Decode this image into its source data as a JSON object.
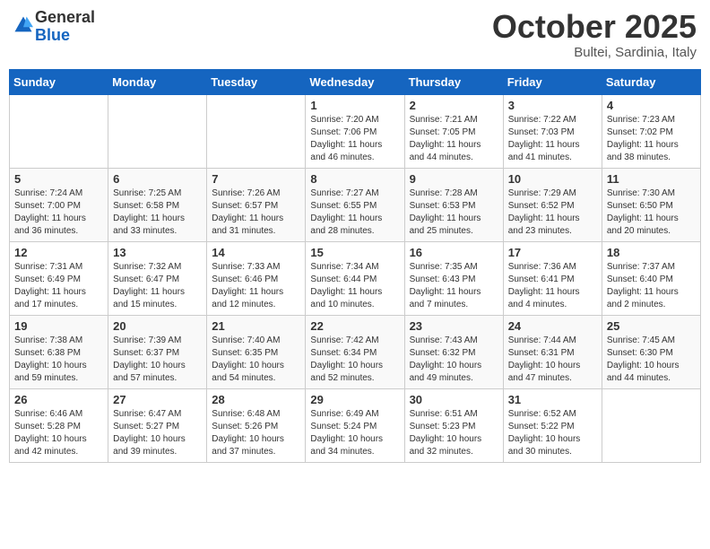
{
  "header": {
    "logo_general": "General",
    "logo_blue": "Blue",
    "month_title": "October 2025",
    "location": "Bultei, Sardinia, Italy"
  },
  "days_of_week": [
    "Sunday",
    "Monday",
    "Tuesday",
    "Wednesday",
    "Thursday",
    "Friday",
    "Saturday"
  ],
  "weeks": [
    [
      {
        "day": "",
        "info": ""
      },
      {
        "day": "",
        "info": ""
      },
      {
        "day": "",
        "info": ""
      },
      {
        "day": "1",
        "info": "Sunrise: 7:20 AM\nSunset: 7:06 PM\nDaylight: 11 hours and 46 minutes."
      },
      {
        "day": "2",
        "info": "Sunrise: 7:21 AM\nSunset: 7:05 PM\nDaylight: 11 hours and 44 minutes."
      },
      {
        "day": "3",
        "info": "Sunrise: 7:22 AM\nSunset: 7:03 PM\nDaylight: 11 hours and 41 minutes."
      },
      {
        "day": "4",
        "info": "Sunrise: 7:23 AM\nSunset: 7:02 PM\nDaylight: 11 hours and 38 minutes."
      }
    ],
    [
      {
        "day": "5",
        "info": "Sunrise: 7:24 AM\nSunset: 7:00 PM\nDaylight: 11 hours and 36 minutes."
      },
      {
        "day": "6",
        "info": "Sunrise: 7:25 AM\nSunset: 6:58 PM\nDaylight: 11 hours and 33 minutes."
      },
      {
        "day": "7",
        "info": "Sunrise: 7:26 AM\nSunset: 6:57 PM\nDaylight: 11 hours and 31 minutes."
      },
      {
        "day": "8",
        "info": "Sunrise: 7:27 AM\nSunset: 6:55 PM\nDaylight: 11 hours and 28 minutes."
      },
      {
        "day": "9",
        "info": "Sunrise: 7:28 AM\nSunset: 6:53 PM\nDaylight: 11 hours and 25 minutes."
      },
      {
        "day": "10",
        "info": "Sunrise: 7:29 AM\nSunset: 6:52 PM\nDaylight: 11 hours and 23 minutes."
      },
      {
        "day": "11",
        "info": "Sunrise: 7:30 AM\nSunset: 6:50 PM\nDaylight: 11 hours and 20 minutes."
      }
    ],
    [
      {
        "day": "12",
        "info": "Sunrise: 7:31 AM\nSunset: 6:49 PM\nDaylight: 11 hours and 17 minutes."
      },
      {
        "day": "13",
        "info": "Sunrise: 7:32 AM\nSunset: 6:47 PM\nDaylight: 11 hours and 15 minutes."
      },
      {
        "day": "14",
        "info": "Sunrise: 7:33 AM\nSunset: 6:46 PM\nDaylight: 11 hours and 12 minutes."
      },
      {
        "day": "15",
        "info": "Sunrise: 7:34 AM\nSunset: 6:44 PM\nDaylight: 11 hours and 10 minutes."
      },
      {
        "day": "16",
        "info": "Sunrise: 7:35 AM\nSunset: 6:43 PM\nDaylight: 11 hours and 7 minutes."
      },
      {
        "day": "17",
        "info": "Sunrise: 7:36 AM\nSunset: 6:41 PM\nDaylight: 11 hours and 4 minutes."
      },
      {
        "day": "18",
        "info": "Sunrise: 7:37 AM\nSunset: 6:40 PM\nDaylight: 11 hours and 2 minutes."
      }
    ],
    [
      {
        "day": "19",
        "info": "Sunrise: 7:38 AM\nSunset: 6:38 PM\nDaylight: 10 hours and 59 minutes."
      },
      {
        "day": "20",
        "info": "Sunrise: 7:39 AM\nSunset: 6:37 PM\nDaylight: 10 hours and 57 minutes."
      },
      {
        "day": "21",
        "info": "Sunrise: 7:40 AM\nSunset: 6:35 PM\nDaylight: 10 hours and 54 minutes."
      },
      {
        "day": "22",
        "info": "Sunrise: 7:42 AM\nSunset: 6:34 PM\nDaylight: 10 hours and 52 minutes."
      },
      {
        "day": "23",
        "info": "Sunrise: 7:43 AM\nSunset: 6:32 PM\nDaylight: 10 hours and 49 minutes."
      },
      {
        "day": "24",
        "info": "Sunrise: 7:44 AM\nSunset: 6:31 PM\nDaylight: 10 hours and 47 minutes."
      },
      {
        "day": "25",
        "info": "Sunrise: 7:45 AM\nSunset: 6:30 PM\nDaylight: 10 hours and 44 minutes."
      }
    ],
    [
      {
        "day": "26",
        "info": "Sunrise: 6:46 AM\nSunset: 5:28 PM\nDaylight: 10 hours and 42 minutes."
      },
      {
        "day": "27",
        "info": "Sunrise: 6:47 AM\nSunset: 5:27 PM\nDaylight: 10 hours and 39 minutes."
      },
      {
        "day": "28",
        "info": "Sunrise: 6:48 AM\nSunset: 5:26 PM\nDaylight: 10 hours and 37 minutes."
      },
      {
        "day": "29",
        "info": "Sunrise: 6:49 AM\nSunset: 5:24 PM\nDaylight: 10 hours and 34 minutes."
      },
      {
        "day": "30",
        "info": "Sunrise: 6:51 AM\nSunset: 5:23 PM\nDaylight: 10 hours and 32 minutes."
      },
      {
        "day": "31",
        "info": "Sunrise: 6:52 AM\nSunset: 5:22 PM\nDaylight: 10 hours and 30 minutes."
      },
      {
        "day": "",
        "info": ""
      }
    ]
  ]
}
